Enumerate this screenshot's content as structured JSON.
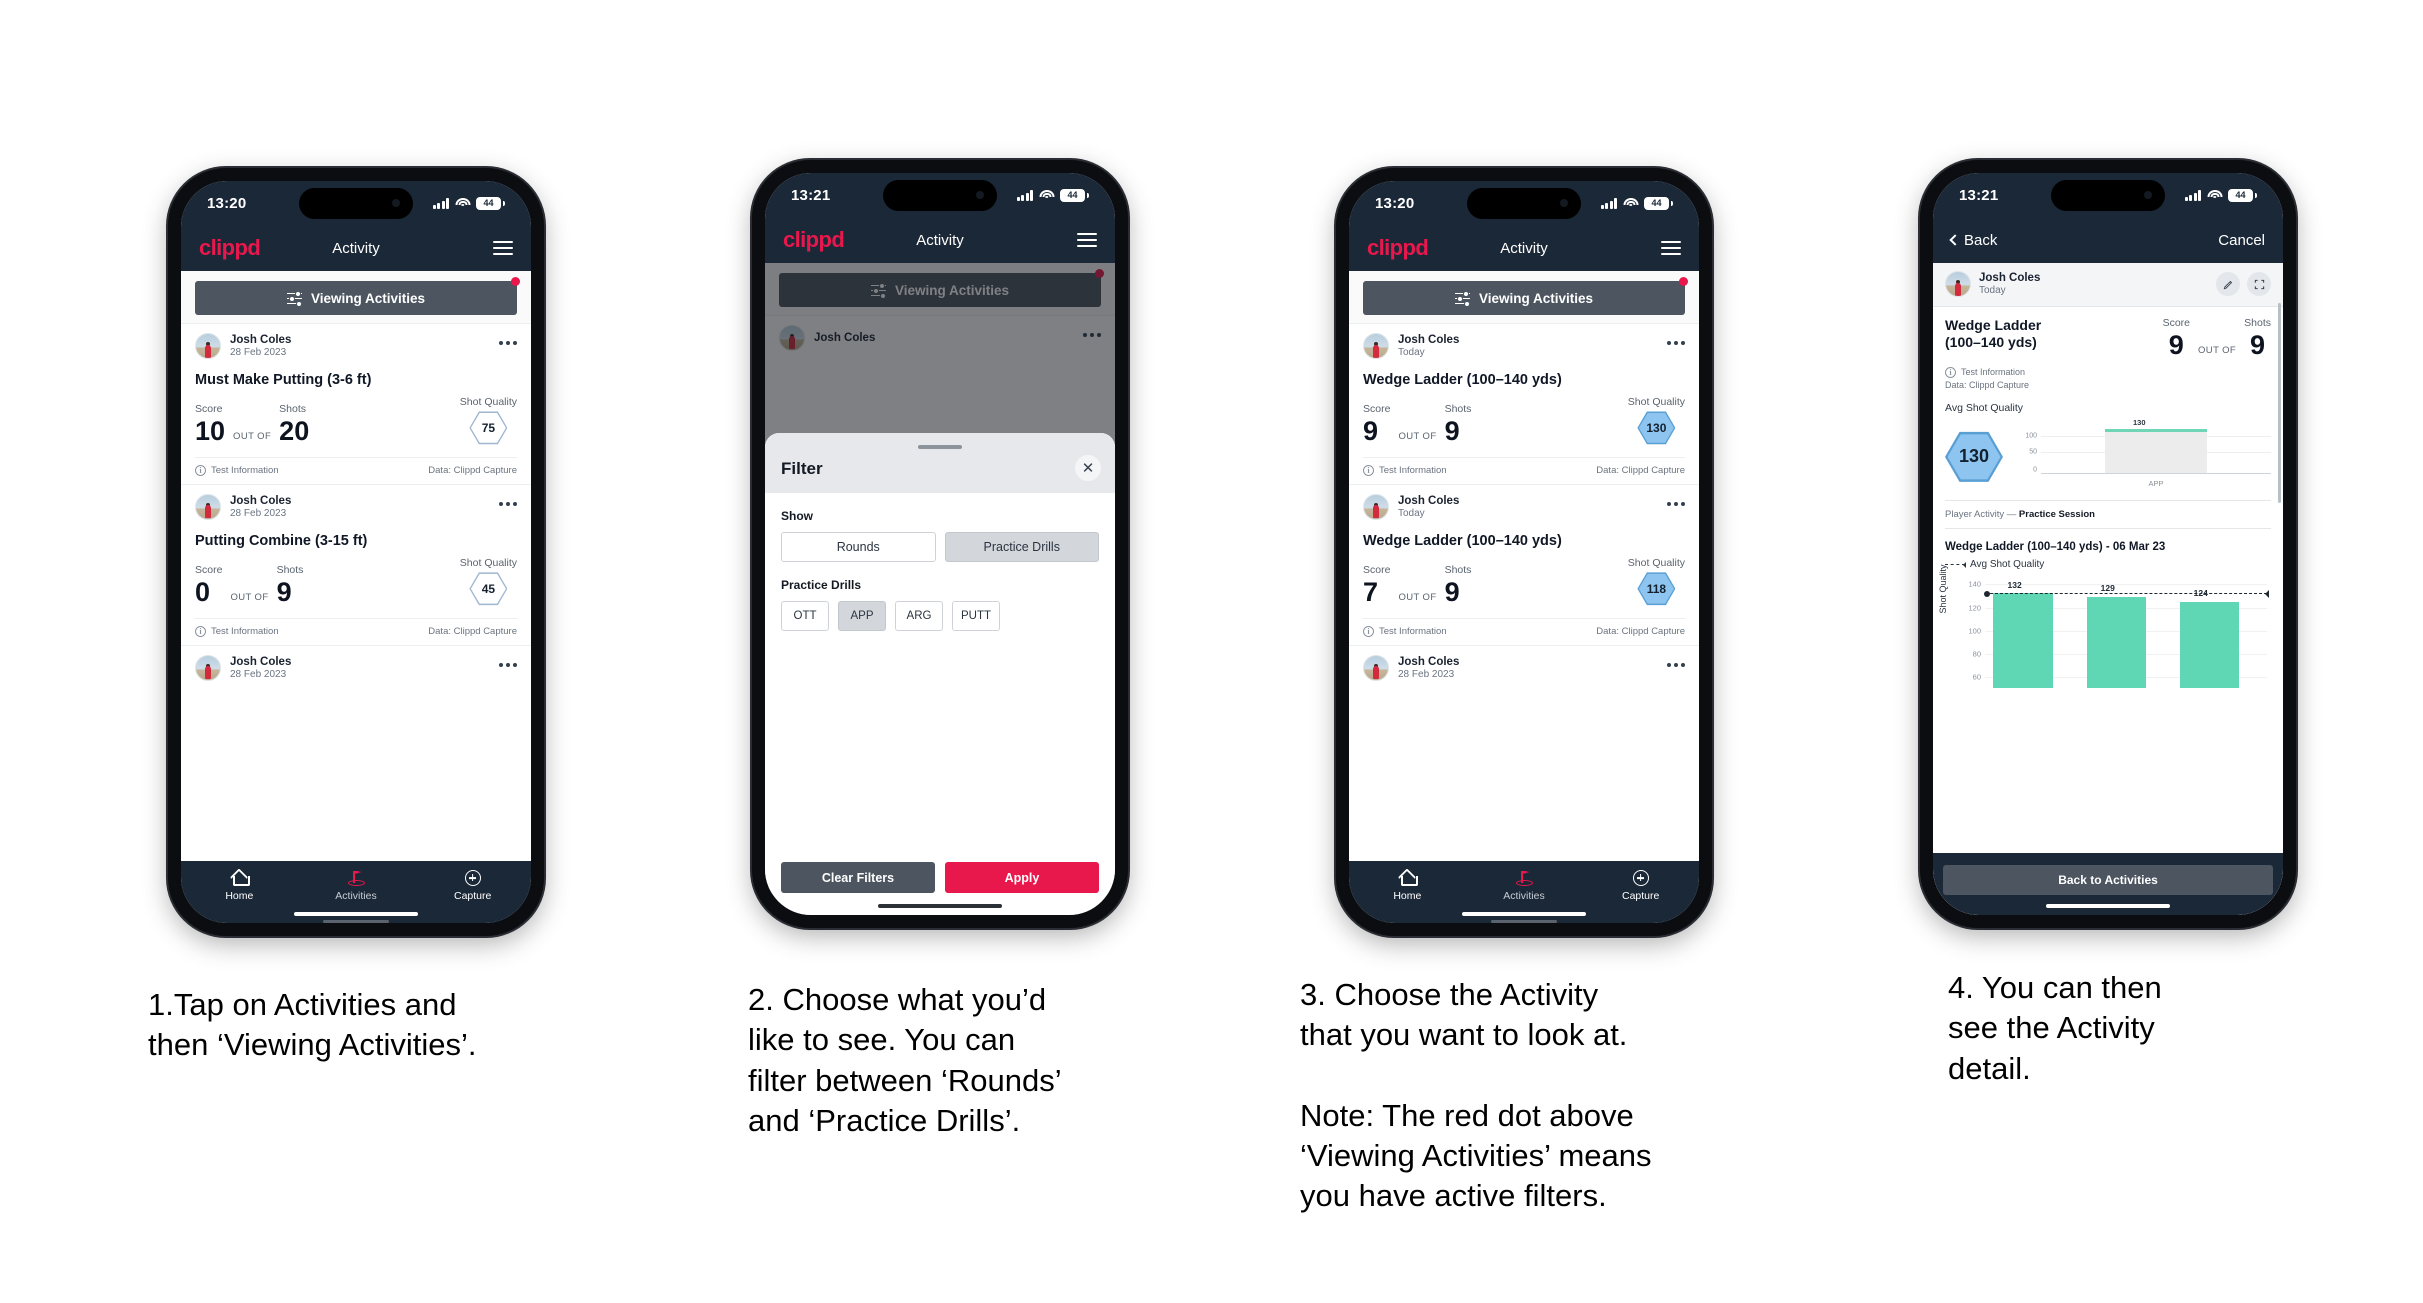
{
  "phone1": {
    "status": {
      "time": "13:20",
      "battery": "44"
    },
    "appbar": {
      "logo": "clippd",
      "title": "Activity"
    },
    "viewing_button": "Viewing Activities",
    "cards": [
      {
        "user": "Josh Coles",
        "date": "28 Feb 2023",
        "title": "Must Make Putting (3-6 ft)",
        "score_label": "Score",
        "shots_label": "Shots",
        "quality_label": "Shot Quality",
        "score": "10",
        "out_of": "OUT OF",
        "shots": "20",
        "quality": "75",
        "quality_filled": false,
        "foot_left": "Test Information",
        "foot_right": "Data: Clippd Capture"
      },
      {
        "user": "Josh Coles",
        "date": "28 Feb 2023",
        "title": "Putting Combine (3-15 ft)",
        "score_label": "Score",
        "shots_label": "Shots",
        "quality_label": "Shot Quality",
        "score": "0",
        "out_of": "OUT OF",
        "shots": "9",
        "quality": "45",
        "quality_filled": false,
        "foot_left": "Test Information",
        "foot_right": "Data: Clippd Capture"
      },
      {
        "user": "Josh Coles",
        "date": "28 Feb 2023"
      }
    ],
    "tabs": [
      {
        "label": "Home",
        "icon": "home-icon",
        "active": false
      },
      {
        "label": "Activities",
        "icon": "golf-flag-icon",
        "active": true
      },
      {
        "label": "Capture",
        "icon": "plus-circle-icon",
        "active": false
      }
    ]
  },
  "phone2": {
    "status": {
      "time": "13:21",
      "battery": "44"
    },
    "appbar": {
      "logo": "clippd",
      "title": "Activity"
    },
    "viewing_button": "Viewing Activities",
    "behind_user": "Josh Coles",
    "sheet": {
      "title": "Filter",
      "close_icon": "close-icon",
      "show_label": "Show",
      "show_options": [
        {
          "label": "Rounds",
          "selected": false
        },
        {
          "label": "Practice Drills",
          "selected": true
        }
      ],
      "drills_label": "Practice Drills",
      "drill_options": [
        {
          "label": "OTT",
          "selected": false
        },
        {
          "label": "APP",
          "selected": true
        },
        {
          "label": "ARG",
          "selected": false
        },
        {
          "label": "PUTT",
          "selected": false
        }
      ],
      "clear_label": "Clear Filters",
      "apply_label": "Apply"
    }
  },
  "phone3": {
    "status": {
      "time": "13:20",
      "battery": "44"
    },
    "appbar": {
      "logo": "clippd",
      "title": "Activity"
    },
    "viewing_button": "Viewing Activities",
    "cards": [
      {
        "user": "Josh Coles",
        "date": "Today",
        "title": "Wedge Ladder (100–140 yds)",
        "score_label": "Score",
        "shots_label": "Shots",
        "quality_label": "Shot Quality",
        "score": "9",
        "out_of": "OUT OF",
        "shots": "9",
        "quality": "130",
        "quality_filled": true,
        "foot_left": "Test Information",
        "foot_right": "Data: Clippd Capture"
      },
      {
        "user": "Josh Coles",
        "date": "Today",
        "title": "Wedge Ladder (100–140 yds)",
        "score_label": "Score",
        "shots_label": "Shots",
        "quality_label": "Shot Quality",
        "score": "7",
        "out_of": "OUT OF",
        "shots": "9",
        "quality": "118",
        "quality_filled": true,
        "foot_left": "Test Information",
        "foot_right": "Data: Clippd Capture"
      },
      {
        "user": "Josh Coles",
        "date": "28 Feb 2023"
      }
    ],
    "tabs": [
      {
        "label": "Home",
        "icon": "home-icon",
        "active": false
      },
      {
        "label": "Activities",
        "icon": "golf-flag-icon",
        "active": true
      },
      {
        "label": "Capture",
        "icon": "plus-circle-icon",
        "active": false
      }
    ]
  },
  "phone4": {
    "status": {
      "time": "13:21",
      "battery": "44"
    },
    "nav": {
      "back": "Back",
      "cancel": "Cancel"
    },
    "header": {
      "user": "Josh Coles",
      "date": "Today",
      "edit_icon": "pencil-icon",
      "expand_icon": "fullscreen-icon"
    },
    "detail": {
      "title": "Wedge Ladder\n(100–140 yds)",
      "title_line1": "Wedge Ladder",
      "title_line2": "(100–140 yds)",
      "score_label": "Score",
      "shots_label": "Shots",
      "score": "9",
      "out_of": "OUT OF",
      "shots": "9",
      "info_line": "Test Information",
      "data_line": "Data: Clippd Capture",
      "avg_label": "Avg Shot Quality",
      "avg_value": "130",
      "session_prefix": "Player Activity — ",
      "session_name": "Practice Session",
      "chart_title": "Wedge Ladder (100–140 yds) - 06 Mar 23",
      "legend": "Avg Shot Quality",
      "back_button": "Back to Activities"
    },
    "chart_data": [
      {
        "type": "bar",
        "title": "Avg Shot Quality by category",
        "categories": [
          "APP"
        ],
        "values": [
          130
        ],
        "labels": [
          "130"
        ],
        "ylabel": "",
        "xlabel": "APP",
        "yticks": [
          0,
          50,
          100
        ],
        "ylim": [
          0,
          140
        ],
        "grid": true
      },
      {
        "type": "bar",
        "title": "Wedge Ladder (100–140 yds) - 06 Mar 23",
        "categories": [
          "1",
          "2",
          "3"
        ],
        "values": [
          132,
          129,
          124
        ],
        "labels": [
          "132",
          "129",
          "124"
        ],
        "ylabel": "Shot Quality",
        "xlabel": "",
        "yticks": [
          60,
          80,
          100,
          120,
          140
        ],
        "ylim": [
          50,
          145
        ],
        "grid": true,
        "legend": [
          "Avg Shot Quality"
        ],
        "legend_position": "top-left",
        "avg_line": 131
      }
    ]
  },
  "captions": [
    "1.Tap on Activities and\nthen ‘Viewing Activities’.",
    "2. Choose what you’d\nlike to see. You can\nfilter between ‘Rounds’\nand ‘Practice Drills’.",
    "3. Choose the Activity\nthat you want to look at.\n\nNote: The red dot above\n‘Viewing Activities’ means\nyou have active filters.",
    "4. You can then\nsee the Activity\ndetail."
  ],
  "colors": {
    "brand_red": "#e8174c",
    "dark_navy": "#1b2838",
    "slate": "#4c5560",
    "hex_blue_fill": "#8ec5f0",
    "hex_blue_stroke": "#5a9fd4",
    "bar_green": "#5fd6b4"
  }
}
